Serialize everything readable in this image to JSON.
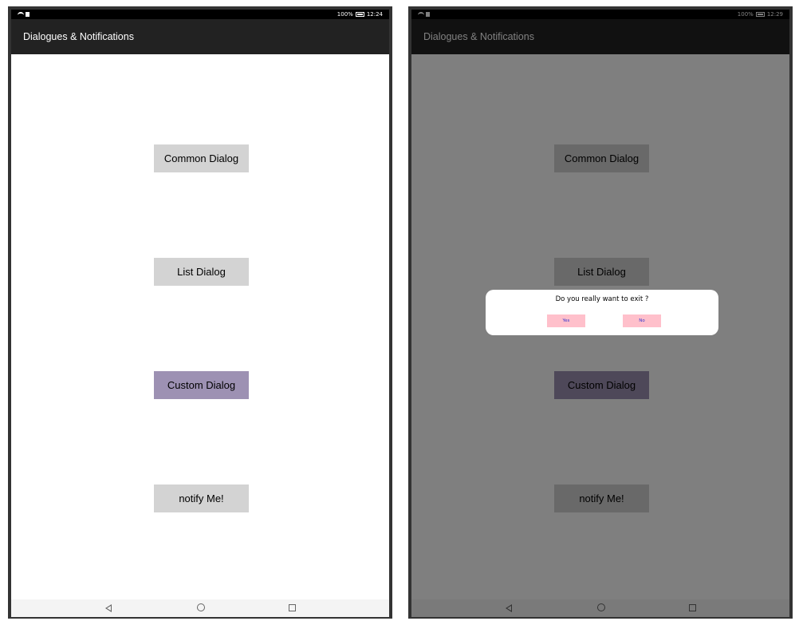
{
  "status_bar": {
    "battery": "100%",
    "time_left": "12:24",
    "time_right": "12:29"
  },
  "app_bar": {
    "title": "Dialogues & Notifications"
  },
  "buttons": {
    "common": "Common Dialog",
    "list": "List Dialog",
    "custom": "Custom Dialog",
    "notify": "notify Me!"
  },
  "dialog": {
    "message": "Do you really want to exit ?",
    "yes": "Yes",
    "no": "No"
  },
  "colors": {
    "button_bg": "#d3d3d3",
    "custom_button_bg": "#9d91b3",
    "dialog_button_bg": "#ffc0cb",
    "dialog_button_text": "#3333cc",
    "app_bar_bg": "#222222"
  },
  "nav_bar": {
    "icons": [
      "back-triangle-icon",
      "home-circle-icon",
      "recent-square-icon"
    ]
  }
}
